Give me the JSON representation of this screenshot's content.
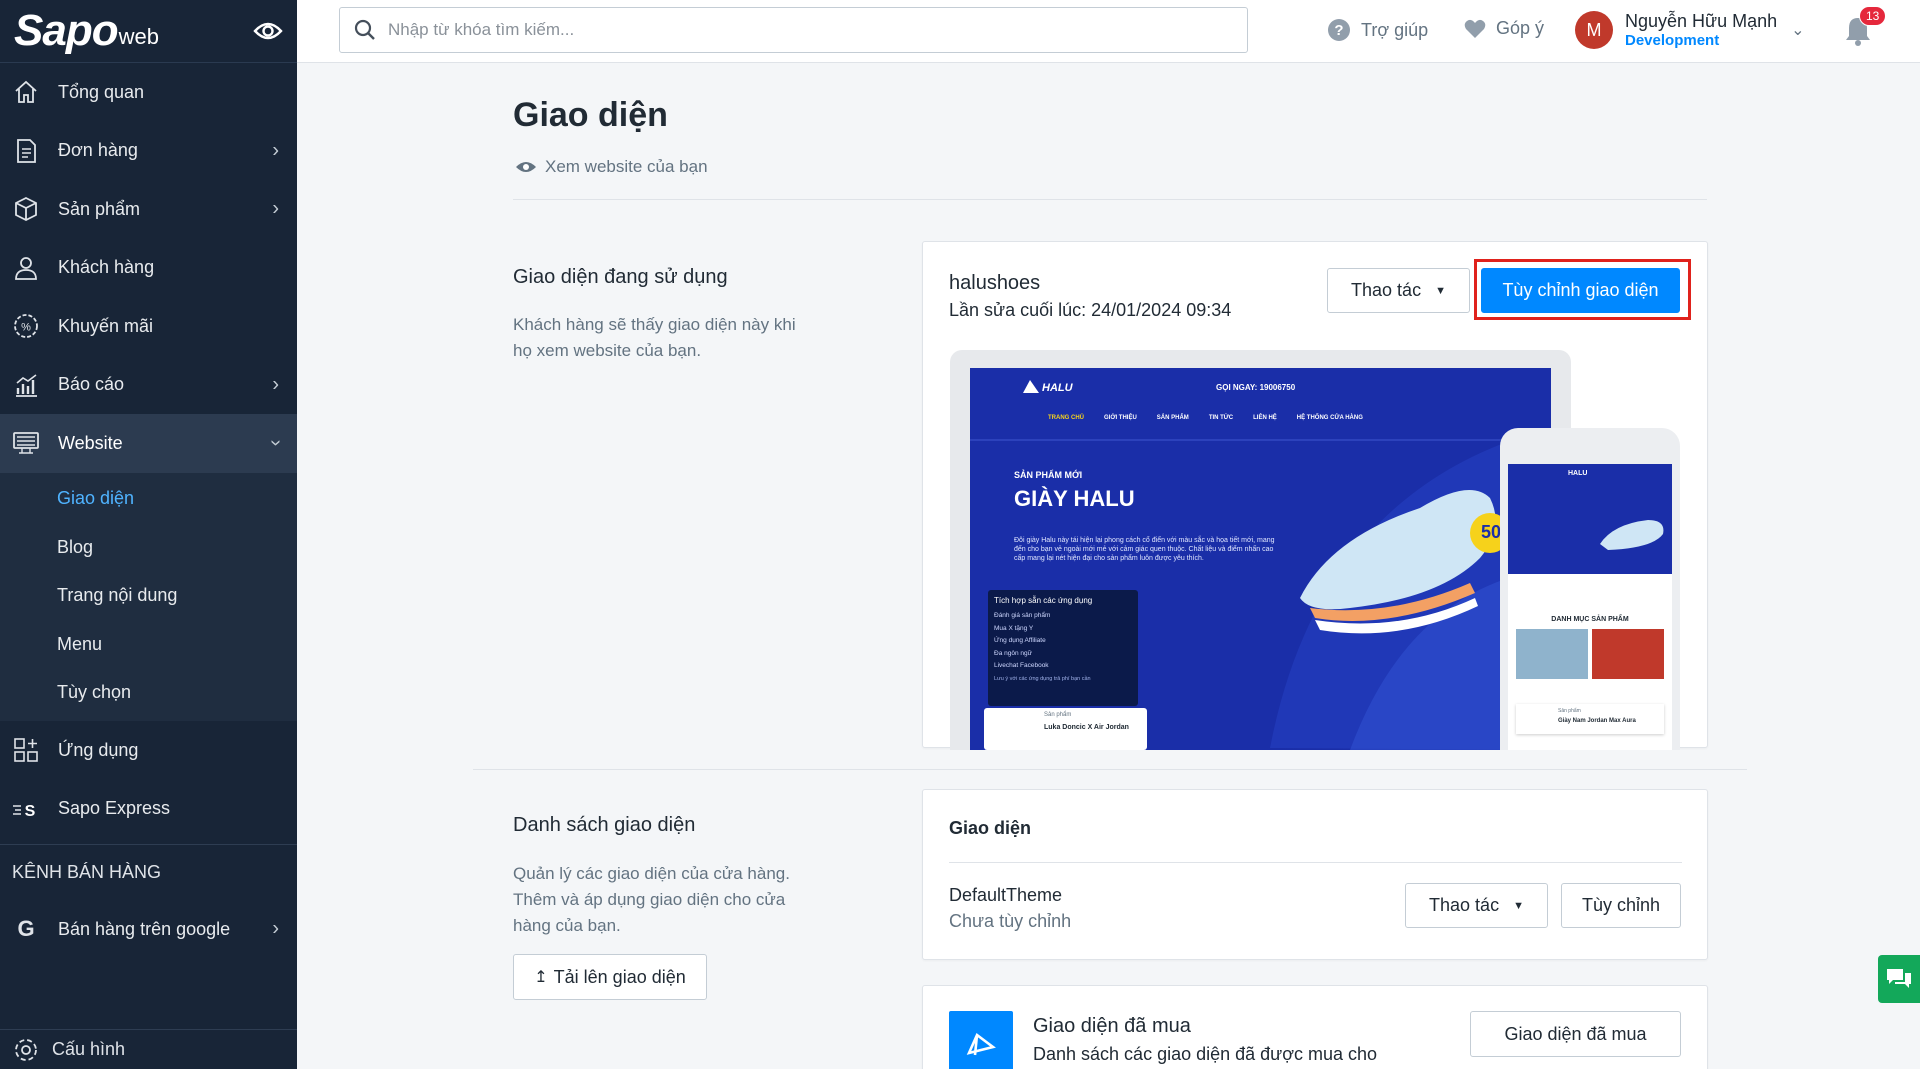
{
  "brand": {
    "logo": "Sapo",
    "logo_suffix": "web"
  },
  "sidebar": {
    "items": [
      {
        "label": "Tổng quan",
        "icon": "home-icon"
      },
      {
        "label": "Đơn hàng",
        "icon": "order-icon"
      },
      {
        "label": "Sản phẩm",
        "icon": "box-icon"
      },
      {
        "label": "Khách hàng",
        "icon": "user-icon"
      },
      {
        "label": "Khuyến mãi",
        "icon": "percent-icon"
      },
      {
        "label": "Báo cáo",
        "icon": "chart-icon"
      },
      {
        "label": "Website",
        "icon": "website-icon"
      }
    ],
    "website_sub": [
      "Giao diện",
      "Blog",
      "Trang nội dung",
      "Menu",
      "Tùy chọn"
    ],
    "apps": {
      "label": "Ứng dụng"
    },
    "express": {
      "label": "Sapo Express"
    },
    "channels_label": "KÊNH BÁN HÀNG",
    "google": {
      "label": "Bán hàng trên google"
    },
    "settings": {
      "label": "Cấu hình"
    }
  },
  "topbar": {
    "search_placeholder": "Nhập từ khóa tìm kiếm...",
    "help": "Trợ giúp",
    "feedback": "Góp ý",
    "user_initial": "M",
    "user_name": "Nguyễn Hữu Mạnh",
    "user_role": "Development",
    "notifications": "13"
  },
  "page": {
    "title": "Giao diện",
    "view_site": "Xem website của bạn"
  },
  "current_theme": {
    "section_title": "Giao diện đang sử dụng",
    "section_desc_1": "Khách hàng sẽ thấy giao diện này khi",
    "section_desc_2": "họ xem website của bạn.",
    "name": "halushoes",
    "last_edited": "Lần sửa cuối lúc: 24/01/2024 09:34",
    "actions_btn": "Thao tác",
    "customize_btn": "Tùy chỉnh giao diện"
  },
  "preview": {
    "brand": "HALU",
    "hotline": "GỌI NGAY: 19006750",
    "nav": [
      "TRANG CHỦ",
      "GIỚI THIỆU",
      "SẢN PHẨM",
      "TIN TỨC",
      "LIÊN HỆ",
      "HỆ THỐNG CỬA HÀNG"
    ],
    "kicker": "SẢN PHẨM MỚI",
    "headline": "GIÀY HALU",
    "body": "Đôi giày Halu này tái hiện lại phong cách cổ điển với màu sắc và họa tiết mới, mang đến cho bạn vẻ ngoài mới mẻ với cảm giác quen thuộc. Chất liệu và điểm nhấn cao cấp mang lại nét hiện đại cho sản phẩm luôn được yêu thích.",
    "badge": "50",
    "popup_title": "Tích hợp sẵn các ứng dụng",
    "popup_items": [
      "Đánh giá sản phẩm",
      "Mua X tặng Y",
      "Ứng dụng Affiliate",
      "Đa ngôn ngữ",
      "Livechat Facebook"
    ],
    "popup_note": "Lưu ý với các ứng dụng trả phí bạn cần",
    "product_label": "Sản phẩm",
    "product_name": "Luka Doncic X Air Jordan",
    "phone_category": "DANH MỤC SẢN PHẨM",
    "phone_product": "Giày Nam Jordan Max Aura"
  },
  "theme_list": {
    "section_title": "Danh sách giao diện",
    "section_desc_1": "Quản lý các giao diện của cửa hàng.",
    "section_desc_2": "Thêm và áp dụng giao diện cho cửa",
    "section_desc_3": "hàng của bạn.",
    "upload_btn": "Tải lên giao diện",
    "card_header": "Giao diện",
    "theme_name": "DefaultTheme",
    "theme_status": "Chưa tùy chỉnh",
    "actions_btn": "Thao tác",
    "customize_btn": "Tùy chỉnh"
  },
  "purchased": {
    "title": "Giao diện đã mua",
    "desc": "Danh sách các giao diện đã được mua cho",
    "btn": "Giao diện đã mua"
  },
  "colors": {
    "sidebar": "#182537",
    "primary": "#0088ff",
    "active_sub": "#4fb3ff",
    "highlight": "#e0221c"
  }
}
